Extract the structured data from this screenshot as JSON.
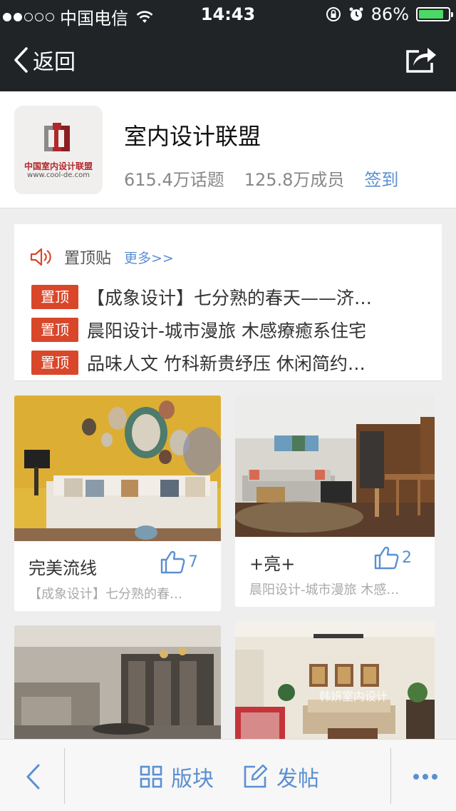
{
  "status_bar": {
    "carrier": "中国电信",
    "time": "14:43",
    "battery_percent": "86%",
    "battery_level": 0.86,
    "signal_dots_filled": 2,
    "signal_dots_total": 5
  },
  "nav": {
    "back_label": "返回"
  },
  "group": {
    "name": "室内设计联盟",
    "topics": "615.4万话题",
    "members": "125.8万成员",
    "signin_label": "签到",
    "logo_text": "中国室内设计联盟",
    "logo_url": "www.cool-de.com"
  },
  "pinned": {
    "title": "置顶贴",
    "more_label": "更多>>",
    "badge": "置顶",
    "items": [
      {
        "text": "【成象设计】七分熟的春天——济…"
      },
      {
        "text": "晨阳设计-城市漫旅 木感療癒系住宅"
      },
      {
        "text": "品味人文 竹科新贵纾压 休闲简约…"
      }
    ]
  },
  "cards": [
    {
      "title": "完美流线",
      "likes": "7",
      "excerpt": "【成象设计】七分熟的春…"
    },
    {
      "title": "+亮+",
      "likes": "2",
      "excerpt": "晨阳设计-城市漫旅 木感…"
    },
    {
      "title": "",
      "likes": "",
      "excerpt": ""
    },
    {
      "title": "",
      "likes": "",
      "excerpt": "",
      "watermark": "韩妍室内设计"
    }
  ],
  "toolbar": {
    "sections_label": "版块",
    "post_label": "发帖"
  },
  "colors": {
    "bar_bg": "#202427",
    "accent": "#5b8fd1",
    "pin_badge": "#d9472b",
    "battery_green": "#4cd964"
  }
}
